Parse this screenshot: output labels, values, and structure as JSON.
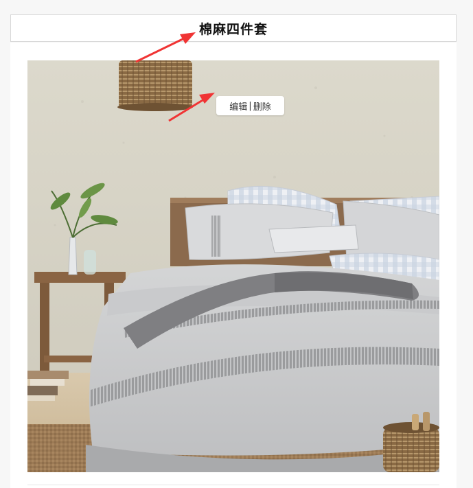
{
  "header": {
    "title": "棉麻四件套"
  },
  "product_image": {
    "alt": "棉麻四件套"
  },
  "actions": {
    "edit_label": "编辑",
    "separator": "|",
    "delete_label": "删除"
  },
  "colors": {
    "arrow": "#f03434",
    "panel_border": "#d8d8d8",
    "background": "#f7f7f7"
  }
}
